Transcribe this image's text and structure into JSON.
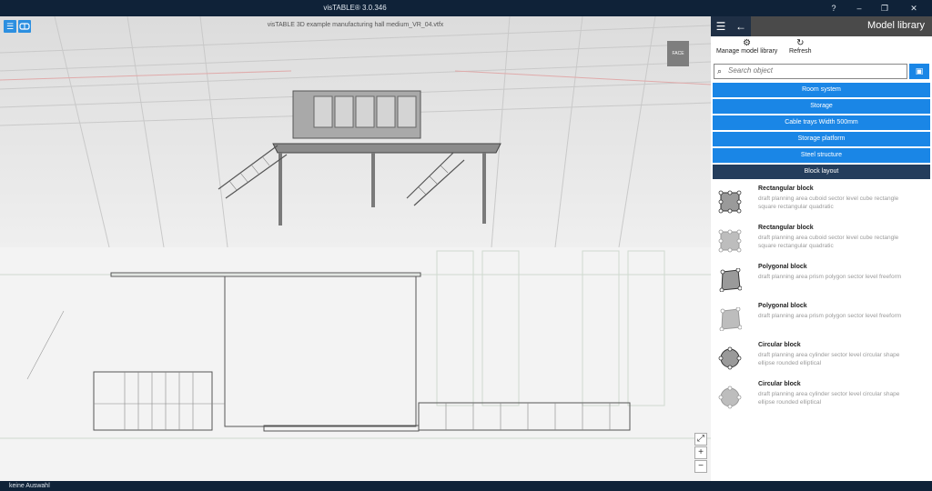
{
  "app": {
    "title": "visTABLE® 3.0.346",
    "file_title": "visTABLE 3D example manufacturing hall medium_VR_04.vtfx",
    "status": "keine Auswahl"
  },
  "window_controls": {
    "help": "?",
    "minimize": "–",
    "restore": "❐",
    "close": "✕"
  },
  "viewport": {
    "menu_icon": "☰",
    "cube_label": "FACE",
    "zoom_fit": "⤢",
    "zoom_in": "+",
    "zoom_out": "−"
  },
  "panel": {
    "title": "Model library",
    "menu_icon": "☰",
    "back_icon": "←",
    "tools": {
      "manage_label": "Manage model library",
      "refresh_label": "Refresh"
    },
    "search_placeholder": "Search object",
    "categories": [
      {
        "label": "Room system",
        "active": false
      },
      {
        "label": "Storage",
        "active": false
      },
      {
        "label": "Cable trays Width 500mm",
        "active": false
      },
      {
        "label": "Storage platform",
        "active": false
      },
      {
        "label": "Steel structure",
        "active": false
      },
      {
        "label": "Block layout",
        "active": true
      }
    ],
    "items": [
      {
        "name": "Rectangular block",
        "desc": "draft planning area cuboid sector level cube rectangle square rectangular quadratic",
        "shape": "rect"
      },
      {
        "name": "Rectangular block",
        "desc": "draft planning area cuboid sector level cube rectangle square rectangular quadratic",
        "shape": "rect-light"
      },
      {
        "name": "Polygonal block",
        "desc": "draft planning area prism polygon sector level freeform",
        "shape": "poly"
      },
      {
        "name": "Polygonal block",
        "desc": "draft planning area prism polygon sector level freeform",
        "shape": "poly-light"
      },
      {
        "name": "Circular block",
        "desc": "draft planning area cylinder sector level circular shape ellipse rounded elliptical",
        "shape": "circle"
      },
      {
        "name": "Circular block",
        "desc": "draft planning area cylinder sector level circular shape ellipse rounded elliptical",
        "shape": "circle-light"
      }
    ]
  }
}
